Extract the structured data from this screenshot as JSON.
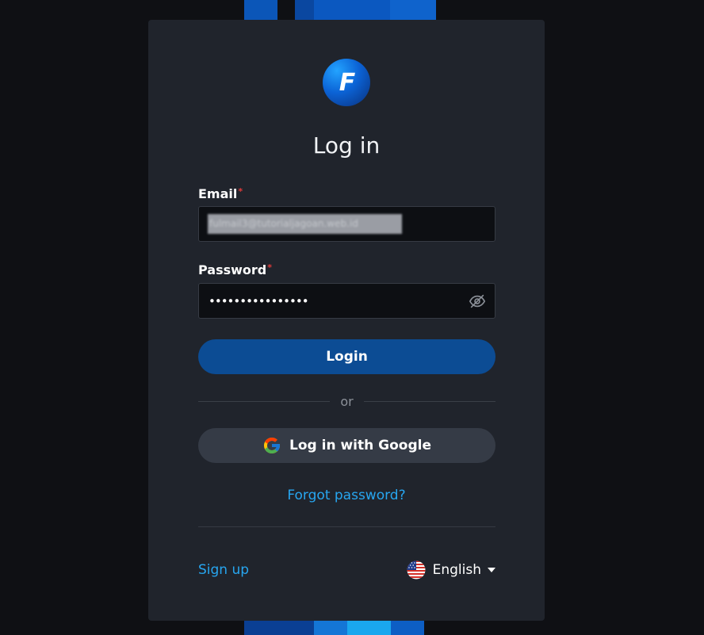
{
  "logo": {
    "letter": "F"
  },
  "title": "Log in",
  "email": {
    "label": "Email",
    "required_mark": "*",
    "value": "fulmail3@tutorialjagoan.web.id"
  },
  "password": {
    "label": "Password",
    "required_mark": "*",
    "value": "••••••••••••••••"
  },
  "login_button": "Login",
  "divider": "or",
  "google_button": "Log in with Google",
  "forgot_password": "Forgot password?",
  "signup": "Sign up",
  "language": {
    "selected": "English",
    "icon": "us-flag-icon"
  },
  "colors": {
    "background": "#0f1014",
    "card": "#20242c",
    "primary_button": "#0c4c94",
    "secondary_button": "#353b46",
    "link": "#27a6f0",
    "required": "#e33b3b"
  }
}
